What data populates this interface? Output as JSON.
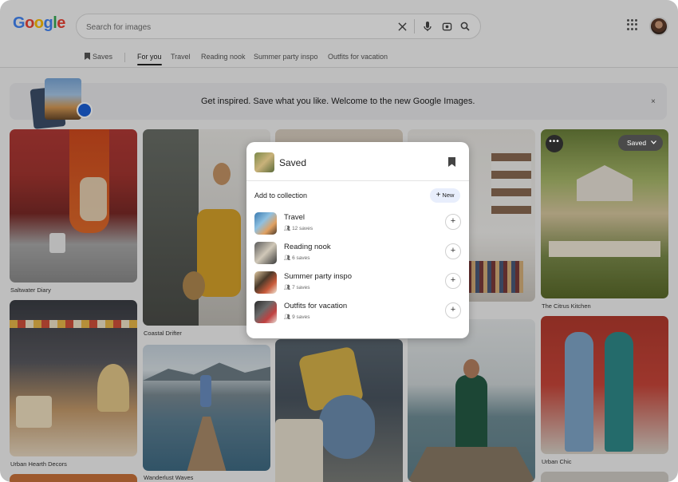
{
  "brand": {
    "logo_letters": [
      {
        "char": "G",
        "color": "#4285F4"
      },
      {
        "char": "o",
        "color": "#EA4335"
      },
      {
        "char": "o",
        "color": "#FBBC05"
      },
      {
        "char": "g",
        "color": "#4285F4"
      },
      {
        "char": "l",
        "color": "#34A853"
      },
      {
        "char": "e",
        "color": "#EA4335"
      }
    ]
  },
  "search": {
    "placeholder": "Search for images",
    "value": ""
  },
  "tabs": [
    {
      "label": "Saves",
      "icon": "bookmark-icon"
    },
    {
      "label": "For you",
      "active": true
    },
    {
      "label": "Travel"
    },
    {
      "label": "Reading nook"
    },
    {
      "label": "Summer party inspo"
    },
    {
      "label": "Outfits for vacation"
    }
  ],
  "banner": {
    "text": "Get inspired. Save what you like. Welcome to the new Google Images.",
    "close": "×"
  },
  "pins": [
    {
      "caption": "Saltwater Diary"
    },
    {
      "caption": "Coastal Drifter"
    },
    {
      "caption": "The Citrus Kitchen"
    },
    {
      "caption": "Urban Hearth Decors"
    },
    {
      "caption": "Wanderlust Waves"
    },
    {
      "caption": "Urban Chic"
    }
  ],
  "saved_pill": {
    "label": "Saved"
  },
  "modal": {
    "title": "Saved",
    "subtitle": "Add to collection",
    "new_button": "New",
    "collections": [
      {
        "name": "Travel",
        "saves": "12 saves"
      },
      {
        "name": "Reading nook",
        "saves": "6 saves"
      },
      {
        "name": "Summer party inspo",
        "saves": "7 saves"
      },
      {
        "name": "Outfits for vacation",
        "saves": "9 saves"
      }
    ],
    "add_symbol": "+"
  },
  "colors": {
    "accent": "#1a5fd6",
    "new_button_bg": "#e8eefc"
  }
}
